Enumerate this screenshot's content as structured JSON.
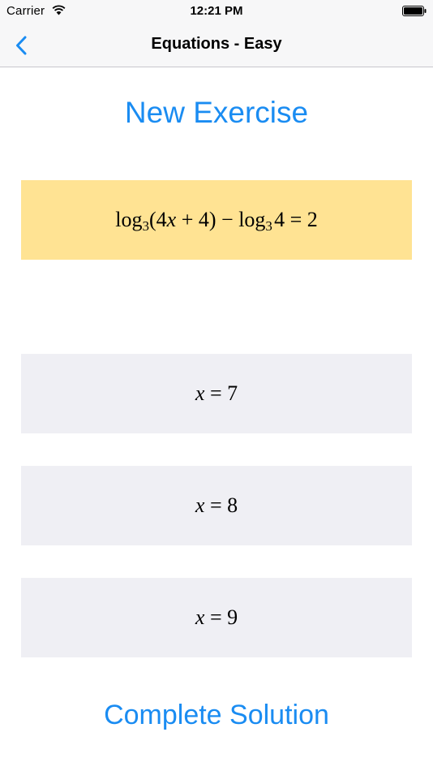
{
  "status_bar": {
    "carrier": "Carrier",
    "time": "12:21 PM",
    "icons": [
      "wifi-icon",
      "battery-icon"
    ]
  },
  "nav": {
    "title": "Equations - Easy",
    "back_icon": "chevron-left-icon"
  },
  "exercise": {
    "new_exercise_label": "New Exercise",
    "equation": {
      "func": "log",
      "base": "3",
      "argument": "(4x + 4)",
      "minus": "−",
      "func2": "log",
      "base2": "3",
      "arg2": "4",
      "equals": "=",
      "rhs": "2"
    }
  },
  "answers": [
    {
      "var": "x",
      "equals": "=",
      "value": "7"
    },
    {
      "var": "x",
      "equals": "=",
      "value": "8"
    },
    {
      "var": "x",
      "equals": "=",
      "value": "9"
    }
  ],
  "complete_solution_label": "Complete Solution",
  "colors": {
    "accent": "#1a8cf2",
    "equation_bg": "#ffe393",
    "answer_bg": "#efeff4",
    "bar_bg": "#f7f7f8"
  }
}
